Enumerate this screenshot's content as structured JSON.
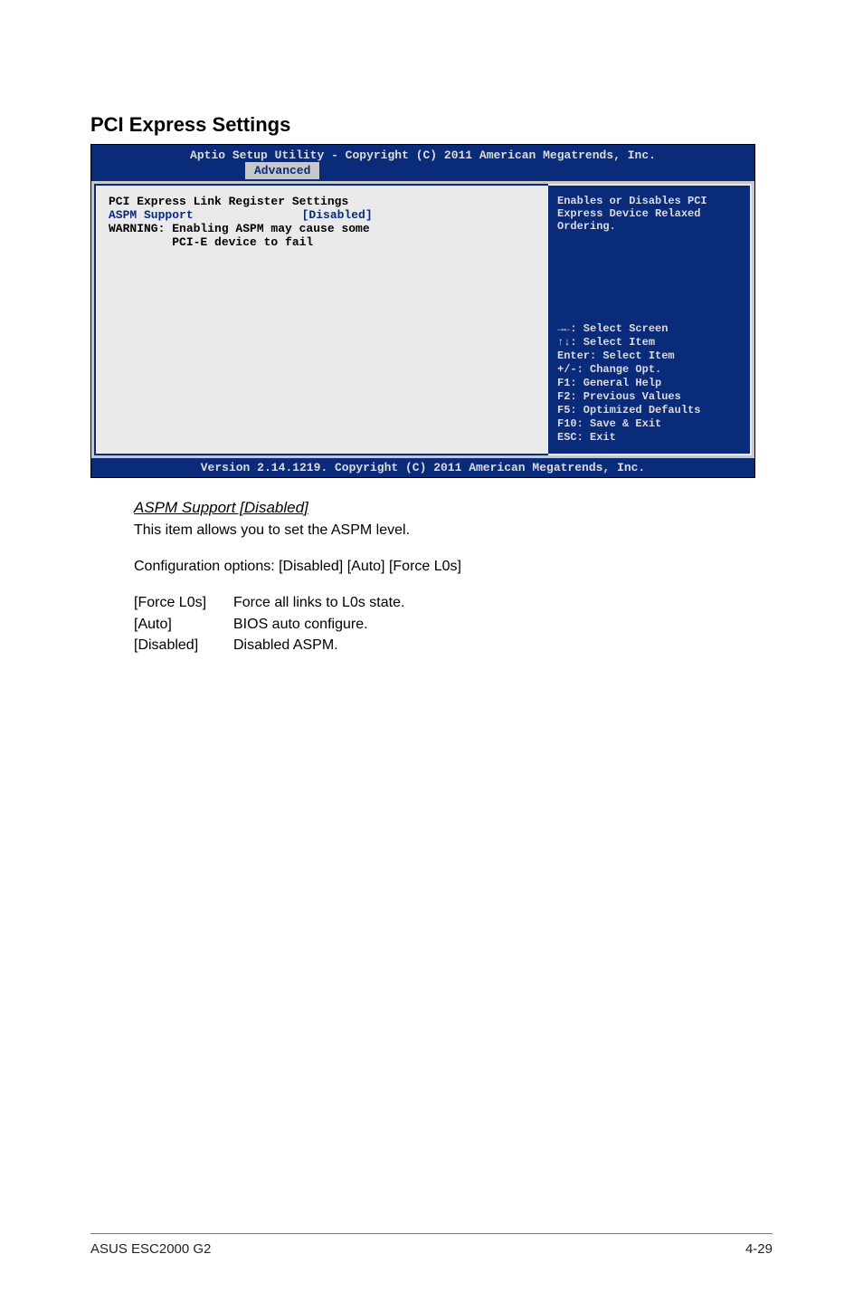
{
  "section_title": "PCI Express Settings",
  "bios": {
    "header": "Aptio Setup Utility - Copyright (C) 2011 American Megatrends, Inc.",
    "tab": "Advanced",
    "left": {
      "heading": "PCI Express Link Register Settings",
      "aspm_label": "ASPM Support",
      "aspm_value": "[Disabled]",
      "warn1": "WARNING: Enabling ASPM may cause some",
      "warn2": "         PCI-E device to fail"
    },
    "help_top_l1": "Enables or Disables PCI",
    "help_top_l2": "Express Device Relaxed",
    "help_top_l3": "Ordering.",
    "nav": {
      "l1": "→←: Select Screen",
      "l2": "↑↓:  Select Item",
      "l3": "Enter: Select Item",
      "l4": "+/-: Change Opt.",
      "l5": "F1: General Help",
      "l6": "F2: Previous Values",
      "l7": "F5: Optimized Defaults",
      "l8": "F10: Save & Exit",
      "l9": "ESC: Exit"
    },
    "footer": "Version 2.14.1219. Copyright (C) 2011 American Megatrends, Inc."
  },
  "doc": {
    "sub_title": "ASPM Support [Disabled]",
    "sub_desc": "This item allows you to set the ASPM level.",
    "config": "Configuration options: [Disabled] [Auto] [Force L0s]",
    "opts": [
      {
        "k": "[Force L0s]",
        "v": "Force all links to L0s state."
      },
      {
        "k": "[Auto]",
        "v": "BIOS auto configure."
      },
      {
        "k": "[Disabled]",
        "v": "Disabled ASPM."
      }
    ]
  },
  "footer_left": "ASUS ESC2000 G2",
  "footer_right": "4-29"
}
